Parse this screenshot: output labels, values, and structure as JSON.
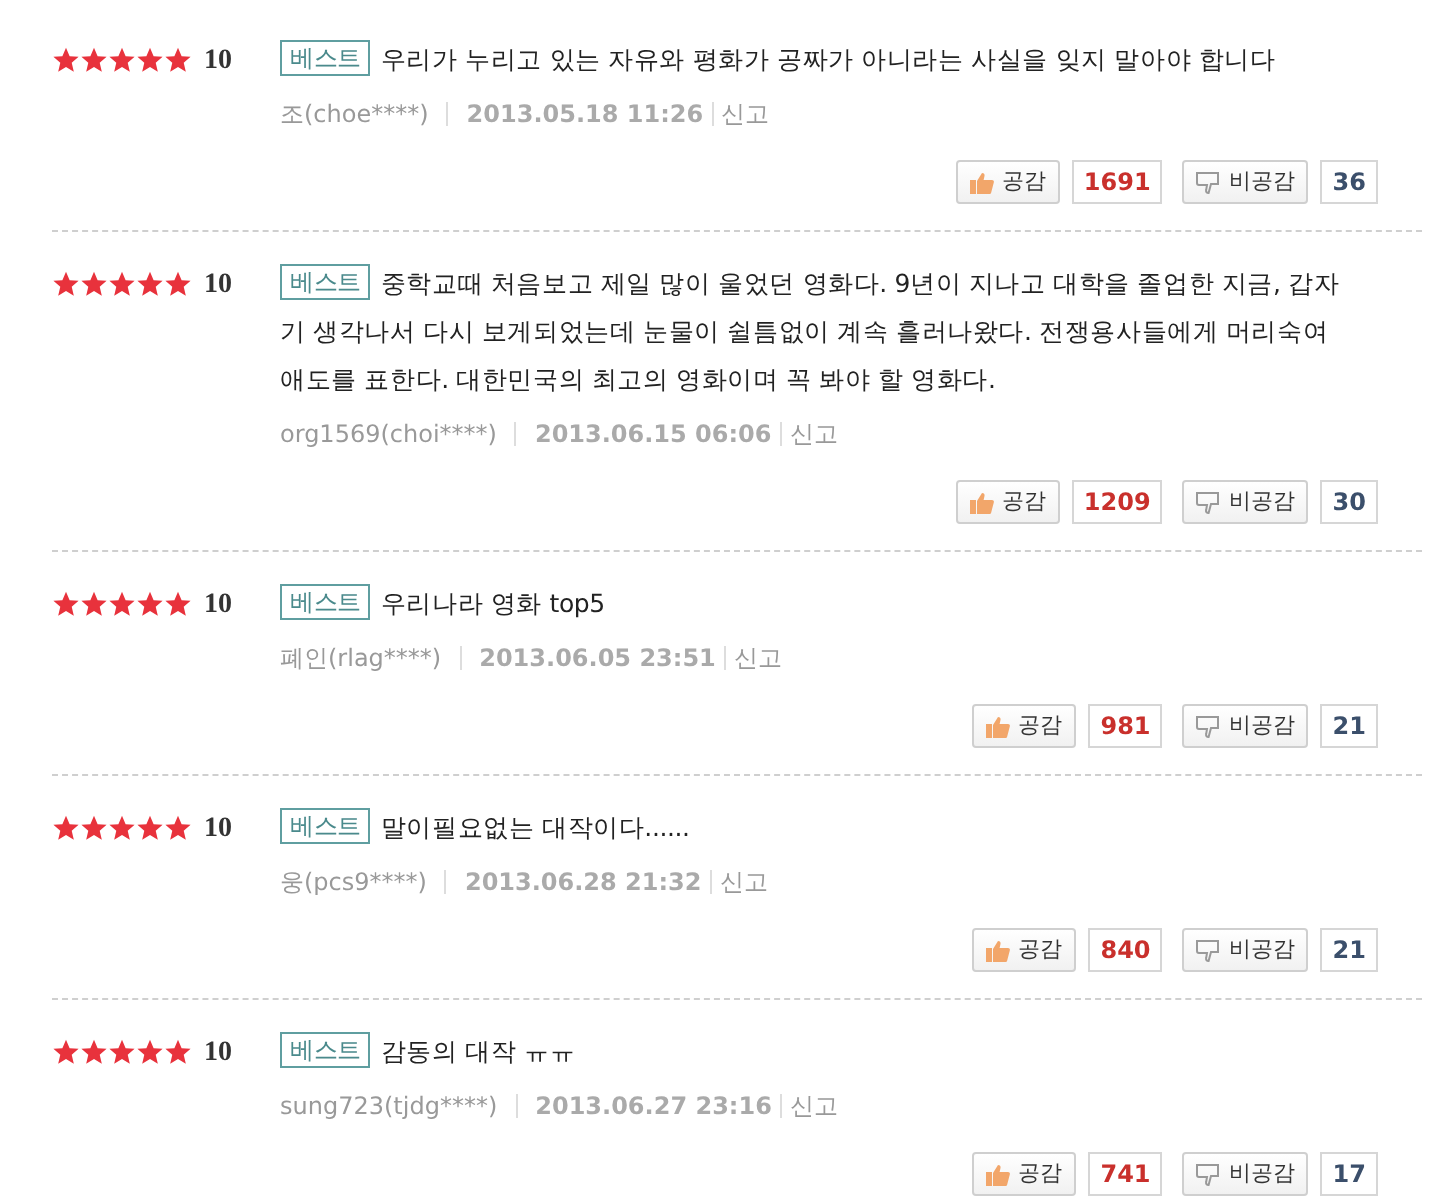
{
  "reviews": [
    {
      "stars": 5,
      "score": "10",
      "badge": "베스트",
      "text": "우리가 누리고 있는 자유와 평화가 공짜가 아니라는 사실을 잊지 말아야 합니다",
      "author": "조(choe****)",
      "date": "2013.05.18 11:26",
      "report": "신고",
      "like_label": "공감",
      "like_count": "1691",
      "dislike_label": "비공감",
      "dislike_count": "36"
    },
    {
      "stars": 5,
      "score": "10",
      "badge": "베스트",
      "text": "중학교때 처음보고 제일 많이 울었던 영화다. 9년이 지나고 대학을 졸업한 지금, 갑자기 생각나서 다시 보게되었는데 눈물이 쉴틈없이 계속 흘러나왔다. 전쟁용사들에게 머리숙여 애도를 표한다. 대한민국의 최고의 영화이며 꼭 봐야 할 영화다.",
      "author": "org1569(choi****)",
      "date": "2013.06.15 06:06",
      "report": "신고",
      "like_label": "공감",
      "like_count": "1209",
      "dislike_label": "비공감",
      "dislike_count": "30"
    },
    {
      "stars": 5,
      "score": "10",
      "badge": "베스트",
      "text": "우리나라 영화 top5",
      "author": "폐인(rlag****)",
      "date": "2013.06.05 23:51",
      "report": "신고",
      "like_label": "공감",
      "like_count": "981",
      "dislike_label": "비공감",
      "dislike_count": "21"
    },
    {
      "stars": 5,
      "score": "10",
      "badge": "베스트",
      "text": "말이필요없는 대작이다......",
      "author": "웅(pcs9****)",
      "date": "2013.06.28 21:32",
      "report": "신고",
      "like_label": "공감",
      "like_count": "840",
      "dislike_label": "비공감",
      "dislike_count": "21"
    },
    {
      "stars": 5,
      "score": "10",
      "badge": "베스트",
      "text": "감동의 대작 ㅠㅠ",
      "author": "sung723(tjdg****)",
      "date": "2013.06.27 23:16",
      "report": "신고",
      "like_label": "공감",
      "like_count": "741",
      "dislike_label": "비공감",
      "dislike_count": "17"
    }
  ]
}
